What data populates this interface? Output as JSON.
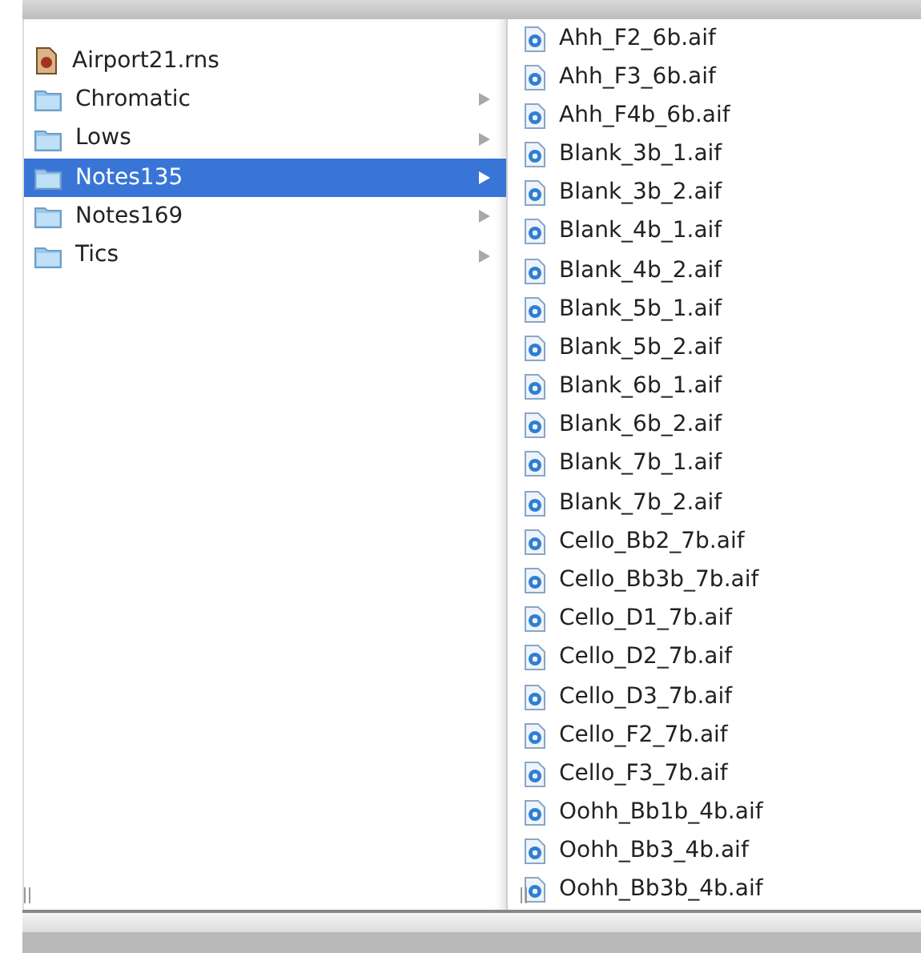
{
  "columns": [
    {
      "items": [
        {
          "name": "Airport21.rns",
          "kind": "document",
          "selected": false
        },
        {
          "name": "Chromatic",
          "kind": "folder",
          "selected": false
        },
        {
          "name": "Lows",
          "kind": "folder",
          "selected": false
        },
        {
          "name": "Notes135",
          "kind": "folder",
          "selected": true
        },
        {
          "name": "Notes169",
          "kind": "folder",
          "selected": false
        },
        {
          "name": "Tics",
          "kind": "folder",
          "selected": false
        }
      ]
    },
    {
      "items": [
        {
          "name": "Ahh_F2_6b.aif",
          "kind": "audio",
          "selected": false
        },
        {
          "name": "Ahh_F3_6b.aif",
          "kind": "audio",
          "selected": false
        },
        {
          "name": "Ahh_F4b_6b.aif",
          "kind": "audio",
          "selected": false
        },
        {
          "name": "Blank_3b_1.aif",
          "kind": "audio",
          "selected": false
        },
        {
          "name": "Blank_3b_2.aif",
          "kind": "audio",
          "selected": false
        },
        {
          "name": "Blank_4b_1.aif",
          "kind": "audio",
          "selected": false
        },
        {
          "name": "Blank_4b_2.aif",
          "kind": "audio",
          "selected": false
        },
        {
          "name": "Blank_5b_1.aif",
          "kind": "audio",
          "selected": false
        },
        {
          "name": "Blank_5b_2.aif",
          "kind": "audio",
          "selected": false
        },
        {
          "name": "Blank_6b_1.aif",
          "kind": "audio",
          "selected": false
        },
        {
          "name": "Blank_6b_2.aif",
          "kind": "audio",
          "selected": false
        },
        {
          "name": "Blank_7b_1.aif",
          "kind": "audio",
          "selected": false
        },
        {
          "name": "Blank_7b_2.aif",
          "kind": "audio",
          "selected": false
        },
        {
          "name": "Cello_Bb2_7b.aif",
          "kind": "audio",
          "selected": false
        },
        {
          "name": "Cello_Bb3b_7b.aif",
          "kind": "audio",
          "selected": false
        },
        {
          "name": "Cello_D1_7b.aif",
          "kind": "audio",
          "selected": false
        },
        {
          "name": "Cello_D2_7b.aif",
          "kind": "audio",
          "selected": false
        },
        {
          "name": "Cello_D3_7b.aif",
          "kind": "audio",
          "selected": false
        },
        {
          "name": "Cello_F2_7b.aif",
          "kind": "audio",
          "selected": false
        },
        {
          "name": "Cello_F3_7b.aif",
          "kind": "audio",
          "selected": false
        },
        {
          "name": "Oohh_Bb1b_4b.aif",
          "kind": "audio",
          "selected": false
        },
        {
          "name": "Oohh_Bb3_4b.aif",
          "kind": "audio",
          "selected": false
        },
        {
          "name": "Oohh_Bb3b_4b.aif",
          "kind": "audio",
          "selected": false
        }
      ]
    }
  ]
}
